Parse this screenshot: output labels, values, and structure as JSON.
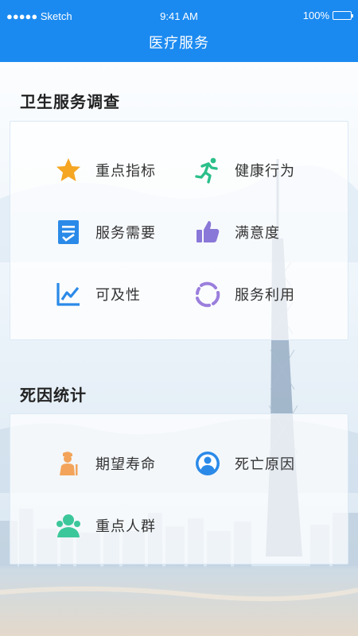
{
  "status_bar": {
    "carrier": "●●●●● Sketch",
    "time": "9:41 AM",
    "battery": "100%"
  },
  "nav": {
    "title": "医疗服务"
  },
  "survey": {
    "title": "卫生服务调查",
    "items": [
      {
        "label": "重点指标",
        "icon": "star-icon"
      },
      {
        "label": "健康行为",
        "icon": "running-person-icon"
      },
      {
        "label": "服务需要",
        "icon": "checklist-icon"
      },
      {
        "label": "满意度",
        "icon": "thumbs-up-icon"
      },
      {
        "label": "可及性",
        "icon": "line-chart-icon"
      },
      {
        "label": "服务利用",
        "icon": "cycle-arrows-icon"
      }
    ]
  },
  "death": {
    "title": "死因统计",
    "items": [
      {
        "label": "期望寿命",
        "icon": "elderly-person-icon"
      },
      {
        "label": "死亡原因",
        "icon": "person-circle-icon"
      },
      {
        "label": "重点人群",
        "icon": "group-people-icon"
      }
    ]
  },
  "colors": {
    "header": "#1b8af0",
    "star": "#f5a623",
    "run": "#2bbf8a",
    "checklist": "#2b8ae8",
    "thumb": "#8a78d8",
    "chart": "#2b8ae8",
    "cycle": "#9b7fdc",
    "elderly": "#f3a45a",
    "person": "#2b8ae8",
    "group": "#3cc79a"
  }
}
